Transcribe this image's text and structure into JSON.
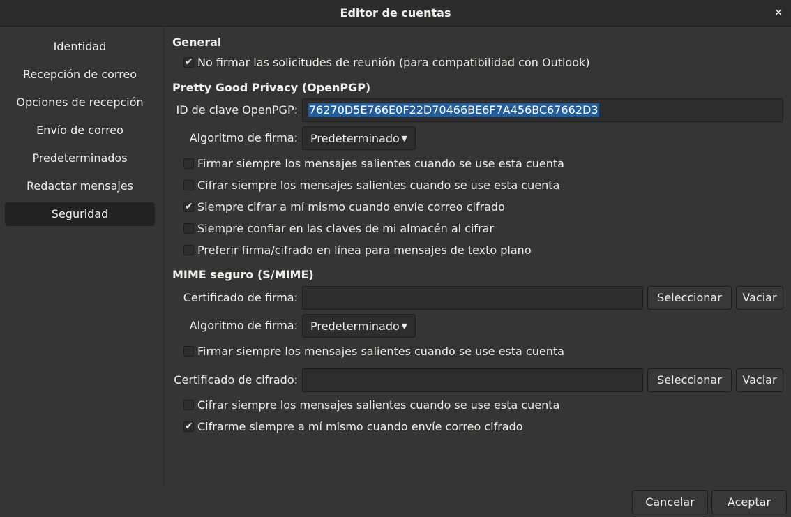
{
  "window": {
    "title": "Editor de cuentas",
    "close_glyph": "✕",
    "close_icon": "close-icon"
  },
  "sidebar": {
    "items": [
      {
        "label": "Identidad"
      },
      {
        "label": "Recepción de correo"
      },
      {
        "label": "Opciones de recepción"
      },
      {
        "label": "Envío de correo"
      },
      {
        "label": "Predeterminados"
      },
      {
        "label": "Redactar mensajes"
      },
      {
        "label": "Seguridad",
        "selected": true
      }
    ]
  },
  "general": {
    "heading": "General",
    "no_sign_meetings": {
      "label": "No firmar las solicitudes de reunión (para compatibilidad con Outlook)",
      "checked": true
    }
  },
  "pgp": {
    "heading": "Pretty Good Privacy (OpenPGP)",
    "key_id_label": "ID de clave OpenPGP:",
    "key_id_value": "76270D5E766E0F22D70466BE6F7A456BC67662D3",
    "sign_algo_label": "Algoritmo de firma:",
    "sign_algo_value": "Predeterminado",
    "options": [
      {
        "label": "Firmar siempre los mensajes salientes cuando se use esta cuenta",
        "checked": false
      },
      {
        "label": "Cifrar siempre los mensajes salientes cuando se use esta cuenta",
        "checked": false
      },
      {
        "label": "Siempre cifrar a mí mismo cuando envíe correo cifrado",
        "checked": true
      },
      {
        "label": "Siempre confiar en las claves de mi almacén al cifrar",
        "checked": false
      },
      {
        "label": "Preferir firma/cifrado en línea para mensajes de texto plano",
        "checked": false
      }
    ]
  },
  "smime": {
    "heading": "MIME seguro (S/MIME)",
    "sign_cert_label": "Certificado de firma:",
    "sign_cert_value": "",
    "select_label": "Seleccionar",
    "clear_label": "Vaciar",
    "sign_algo_label": "Algoritmo de firma:",
    "sign_algo_value": "Predeterminado",
    "always_sign": {
      "label": "Firmar siempre los mensajes salientes cuando se use esta cuenta",
      "checked": false
    },
    "enc_cert_label": "Certificado de cifrado:",
    "enc_cert_value": "",
    "always_encrypt": {
      "label": "Cifrar siempre los mensajes salientes cuando se use esta cuenta",
      "checked": false
    },
    "encrypt_self": {
      "label": "Cifrarme siempre a mí mismo cuando envíe correo cifrado",
      "checked": true
    }
  },
  "footer": {
    "cancel_label": "Cancelar",
    "accept_label": "Aceptar"
  },
  "glyphs": {
    "check": "✔",
    "caret": "▼"
  },
  "colors": {
    "background": "#353535",
    "selection": "#215d9c",
    "sidebar_selected": "#222222"
  }
}
